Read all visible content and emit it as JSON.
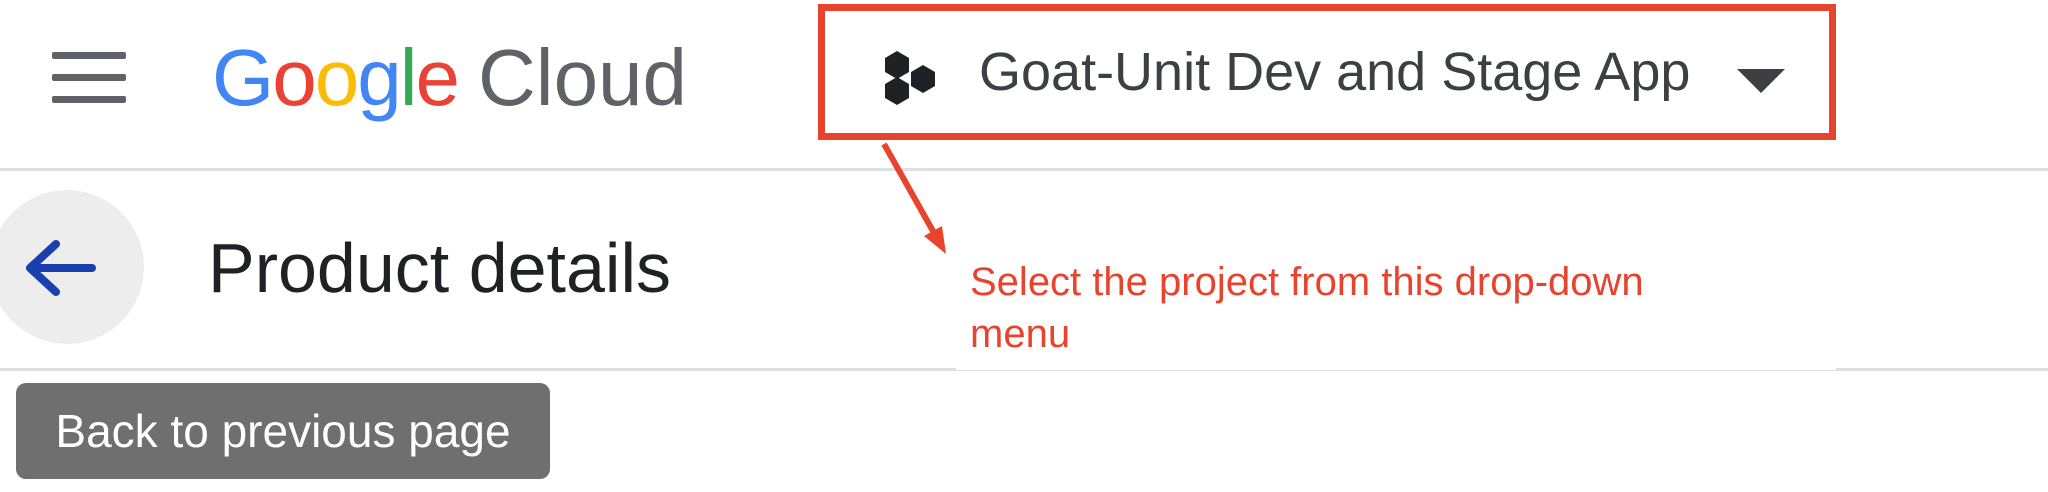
{
  "header": {
    "logo": {
      "brand_letters": [
        "G",
        "o",
        "o",
        "g",
        "l",
        "e"
      ],
      "product": "Cloud"
    },
    "project": {
      "name": "Goat-Unit Dev and Stage App",
      "icon": "hexagon-cluster-icon",
      "caret_icon": "caret-down-icon"
    },
    "menu_icon": "hamburger-menu-icon"
  },
  "page": {
    "title": "Product details",
    "back_icon": "arrow-back-icon"
  },
  "annotation": {
    "text": "Select the project from this drop-down menu",
    "color": "#e8432d"
  },
  "back_button": {
    "label": "Back to previous page"
  },
  "colors": {
    "google_blue": "#4285f4",
    "google_red": "#ea4335",
    "google_yellow": "#fbbc05",
    "google_green": "#34a853",
    "annotation_red": "#e8432d",
    "back_arrow": "#1a3fae",
    "button_gray": "#6f6f6f"
  }
}
